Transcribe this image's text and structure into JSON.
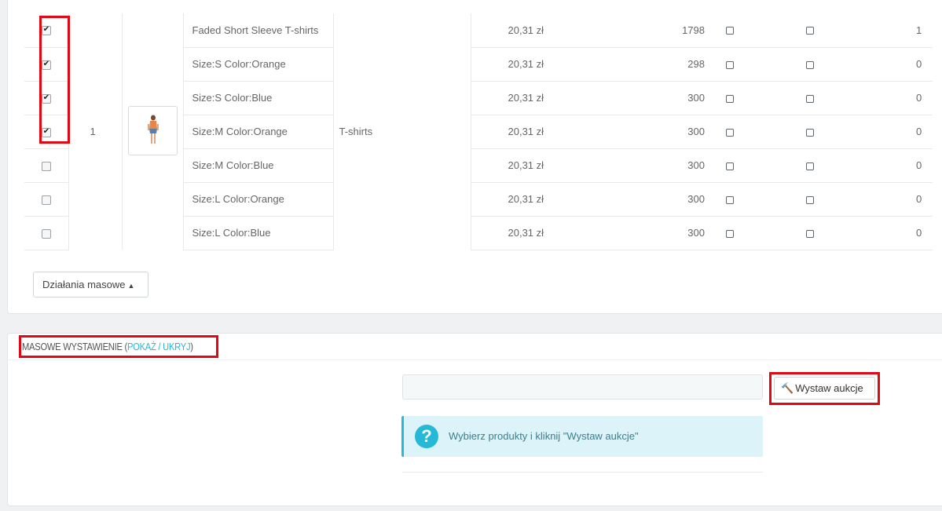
{
  "table": {
    "group": {
      "id": "1",
      "category": "T-shirts",
      "thumbnail_icon": "product-photo-woman-thumbnail"
    },
    "rows": [
      {
        "name": "Faded Short Sleeve T-shirts",
        "price": "20,31 zł",
        "qty": "1798",
        "last": "1",
        "checked": true
      },
      {
        "name": "Size:S Color:Orange",
        "price": "20,31 zł",
        "qty": "298",
        "last": "0",
        "checked": true
      },
      {
        "name": "Size:S Color:Blue",
        "price": "20,31 zł",
        "qty": "300",
        "last": "0",
        "checked": true
      },
      {
        "name": "Size:M Color:Orange",
        "price": "20,31 zł",
        "qty": "300",
        "last": "0",
        "checked": true
      },
      {
        "name": "Size:M Color:Blue",
        "price": "20,31 zł",
        "qty": "300",
        "last": "0",
        "checked": false
      },
      {
        "name": "Size:L Color:Orange",
        "price": "20,31 zł",
        "qty": "300",
        "last": "0",
        "checked": false
      },
      {
        "name": "Size:L Color:Blue",
        "price": "20,31 zł",
        "qty": "300",
        "last": "0",
        "checked": false
      }
    ]
  },
  "bulk_actions": {
    "label": "Działania masowe",
    "caret_icon": "caret-up-icon"
  },
  "mass_listing": {
    "title": "MASOWE WYSTAWIENIE",
    "toggle_open": "(",
    "toggle_show": "POKAŻ",
    "toggle_sep": " / ",
    "toggle_hide": "UKRYJ",
    "toggle_close": ")",
    "input_value": "",
    "submit_label": "Wystaw aukcje",
    "submit_icon": "hammer-icon",
    "info_icon": "question-circle-icon",
    "info_text": "Wybierz produkty i kliknij \"Wystaw aukcje\""
  },
  "colors": {
    "accent": "#25b9d7",
    "highlight": "#e30613",
    "info_bg": "#dcf4f9"
  }
}
